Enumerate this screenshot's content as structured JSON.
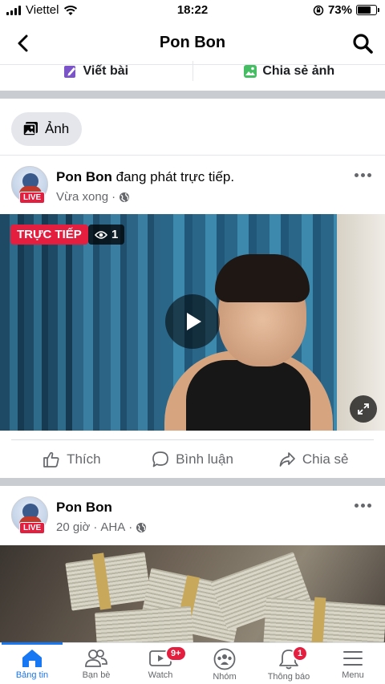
{
  "status_bar": {
    "carrier": "Viettel",
    "time": "18:22",
    "battery": "73%",
    "battery_level": 0.73
  },
  "header": {
    "title": "Pon Bon"
  },
  "actions": {
    "write_post": "Viết bài",
    "share_photo": "Chia sẻ ảnh"
  },
  "photo_chip": {
    "label": "Ảnh"
  },
  "posts": [
    {
      "name": "Pon Bon",
      "action_text": " đang phát trực tiếp.",
      "time": "Vừa xong",
      "separator": "·",
      "live_badge": "LIVE",
      "live_tag": "TRỰC TIẾP",
      "viewer_count": "1",
      "reactions": {
        "like": "Thích",
        "comment": "Bình luận",
        "share": "Chia sẻ"
      }
    },
    {
      "name": "Pon Bon",
      "time": "20 giờ",
      "separator": "·",
      "extra": "AHA",
      "live_badge": "LIVE"
    }
  ],
  "bottom_nav": [
    {
      "label": "Bảng tin",
      "icon": "home-icon",
      "active": true
    },
    {
      "label": "Bạn bè",
      "icon": "friends-icon"
    },
    {
      "label": "Watch",
      "icon": "watch-icon",
      "badge": "9+"
    },
    {
      "label": "Nhóm",
      "icon": "groups-icon"
    },
    {
      "label": "Thông báo",
      "icon": "bell-icon",
      "badge": "1"
    },
    {
      "label": "Menu",
      "icon": "menu-icon"
    }
  ],
  "colors": {
    "accent": "#1877f2",
    "live_red": "#e41e3f",
    "secondary_text": "#65676b"
  }
}
